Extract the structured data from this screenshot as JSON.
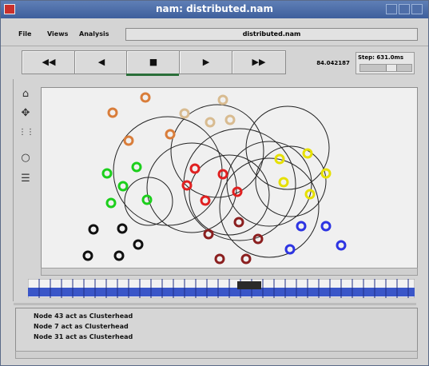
{
  "window": {
    "title": "nam: distributed.nam"
  },
  "menu": {
    "items": [
      "File",
      "Views",
      "Analysis"
    ],
    "filename": "distributed.nam"
  },
  "controls": {
    "rewind": "◀◀",
    "back": "◀",
    "stop": "■",
    "play": "▶",
    "forward": "▶▶",
    "time": "84.042187",
    "step_label": "Step: 631.0ms"
  },
  "tools": {
    "icons": [
      "home-icon",
      "pan-icon",
      "zoom-icon",
      "circle-icon",
      "notes-icon"
    ]
  },
  "log": {
    "lines": [
      "Node 43 act as Clusterhead",
      "Node 7 act as Clusterhead",
      "Node 31 act as Clusterhead"
    ]
  },
  "colors": {
    "titlebar": "#4b6aa5",
    "green": "#1ccf1c",
    "orange": "#d97d3a",
    "tan": "#d8bb90",
    "red": "#e02020",
    "darkred": "#8b1f1f",
    "yellow": "#e6e000",
    "blue": "#2d34e2",
    "black": "#101010"
  }
}
